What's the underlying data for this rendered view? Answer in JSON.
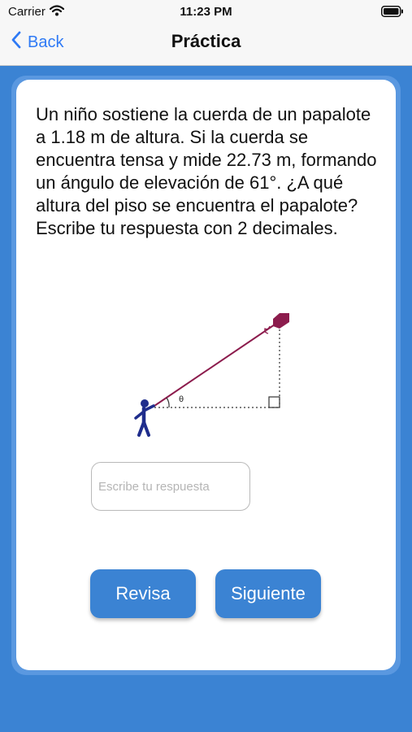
{
  "status_bar": {
    "carrier": "Carrier",
    "time": "11:23 PM"
  },
  "nav": {
    "back_label": "Back",
    "title": "Práctica"
  },
  "question": {
    "text": "Un niño sostiene la cuerda de un papalote a 1.18 m de altura. Si la cuerda se encuentra tensa y mide 22.73 m, formando un ángulo de elevación de 61°. ¿A qué altura del piso se encuentra el papalote? Escribe tu respuesta con 2 decimales."
  },
  "diagram": {
    "angle_label": "θ"
  },
  "answer": {
    "value": "",
    "placeholder": "Escribe tu respuesta"
  },
  "buttons": {
    "check_label": "Revisa",
    "next_label": "Siguiente"
  },
  "colors": {
    "accent": "#3b83d3",
    "link": "#2f7af5",
    "kite": "#8c1c4d",
    "child": "#1f2d8c"
  }
}
